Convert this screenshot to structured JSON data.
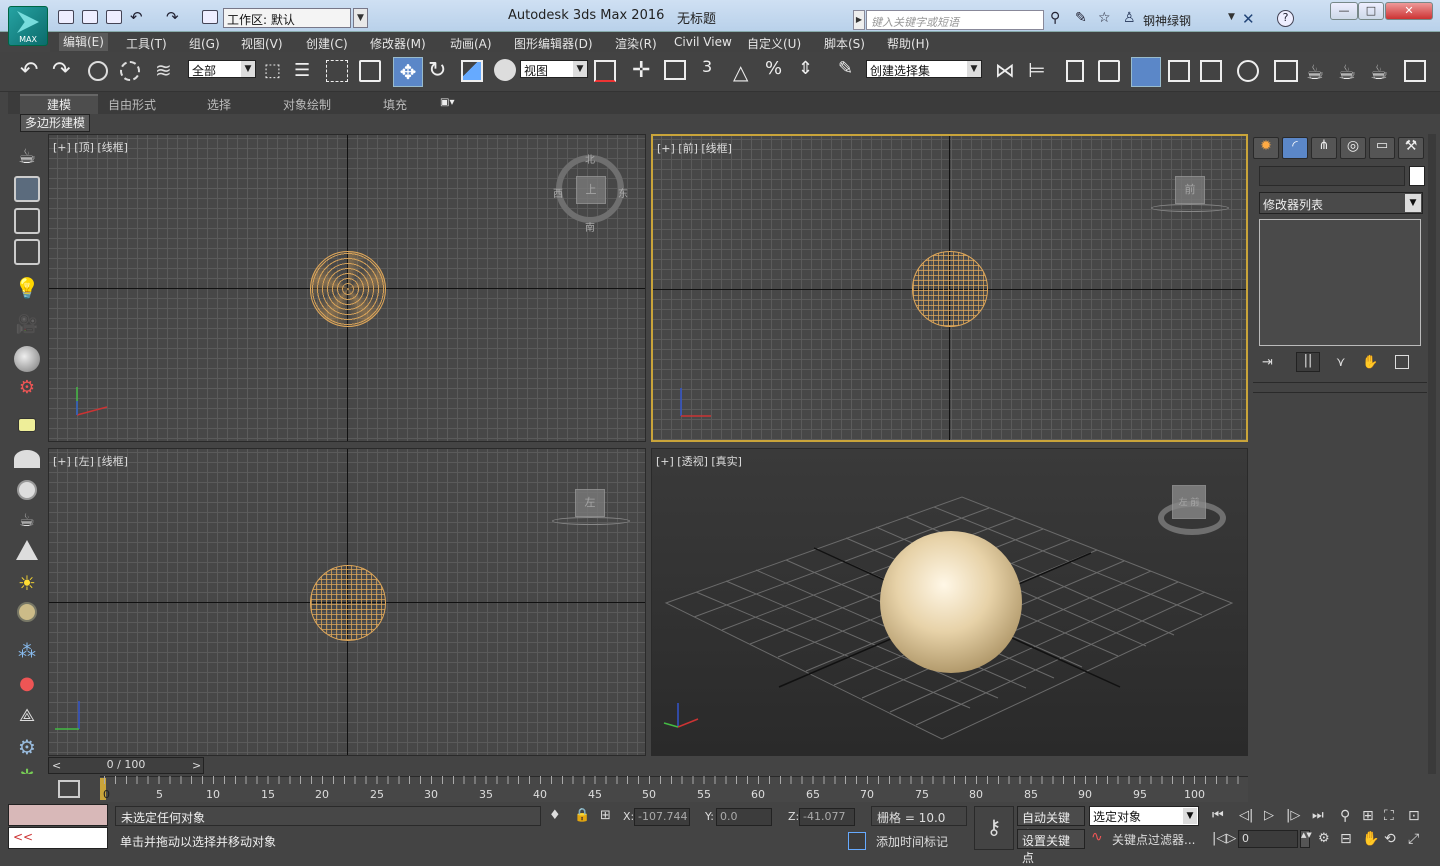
{
  "app": {
    "logo_label": "MAX",
    "title": "Autodesk 3ds Max 2016",
    "document": "无标题",
    "workspace": "工作区: 默认",
    "search_placeholder": "键入关键字或短语",
    "user": "钢神绿钢"
  },
  "menus": [
    "编辑(E)",
    "工具(T)",
    "组(G)",
    "视图(V)",
    "创建(C)",
    "修改器(M)",
    "动画(A)",
    "图形编辑器(D)",
    "渲染(R)",
    "Civil View",
    "自定义(U)",
    "脚本(S)",
    "帮助(H)"
  ],
  "toolbar": {
    "selection_filter": "全部",
    "ref_coord": "视图",
    "snap_angle": "3",
    "selection_set": "创建选择集"
  },
  "ribbon": {
    "tabs": [
      "建模",
      "自由形式",
      "选择",
      "对象绘制",
      "填充"
    ],
    "sub_panel": "多边形建模"
  },
  "viewports": [
    {
      "label": "[+] [顶] [线框]",
      "cube": "上",
      "compass": [
        "北",
        "西",
        "东",
        "南"
      ]
    },
    {
      "label": "[+] [前] [线框]",
      "cube": "前"
    },
    {
      "label": "[+] [左] [线框]",
      "cube": "左"
    },
    {
      "label": "[+] [透视] [真实]",
      "cube": "左 前"
    }
  ],
  "command_panel": {
    "modifier_list": "修改器列表"
  },
  "timeline": {
    "frame": "0 / 100",
    "ticks": [
      "0",
      "5",
      "10",
      "15",
      "20",
      "25",
      "30",
      "35",
      "40",
      "45",
      "50",
      "55",
      "60",
      "65",
      "70",
      "75",
      "80",
      "85",
      "90",
      "95",
      "100"
    ]
  },
  "status": {
    "selection": "未选定任何对象",
    "prompt": "单击并拖动以选择并移动对象",
    "x_label": "X:",
    "x": "-107.744",
    "y_label": "Y:",
    "y": "0.0",
    "z_label": "Z:",
    "z": "-41.077",
    "grid": "栅格 = 10.0",
    "add_time_tag": "添加时间标记",
    "auto_key": "自动关键点",
    "set_key": "设置关键点",
    "key_target": "选定对象",
    "key_filters": "关键点过滤器...",
    "current_frame": "0",
    "script_arrow": "<<"
  }
}
